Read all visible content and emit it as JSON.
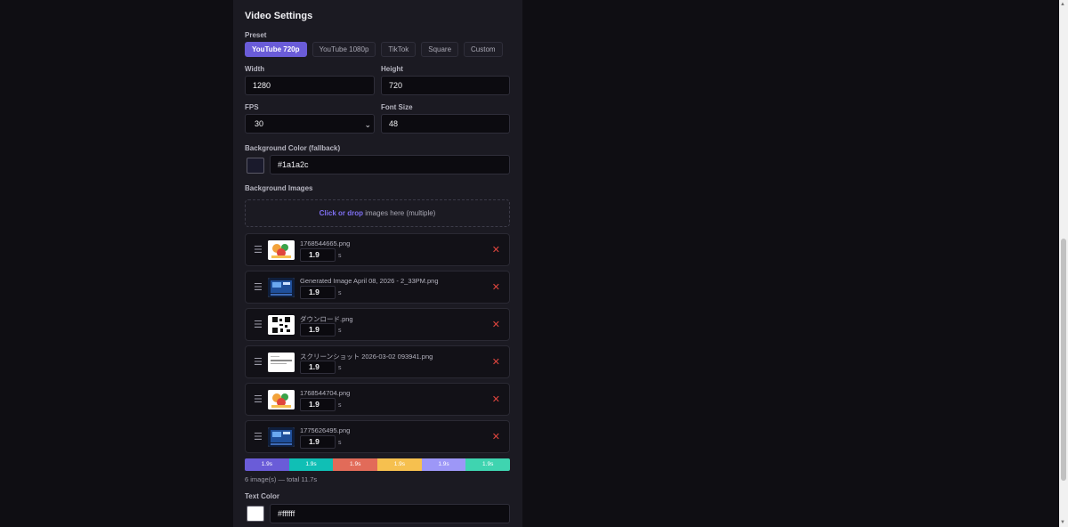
{
  "section_title": "Video Settings",
  "preset": {
    "label": "Preset",
    "options": [
      "YouTube 720p",
      "YouTube 1080p",
      "TikTok",
      "Square",
      "Custom"
    ],
    "active": "YouTube 720p"
  },
  "width": {
    "label": "Width",
    "value": "1280"
  },
  "height": {
    "label": "Height",
    "value": "720"
  },
  "fps": {
    "label": "FPS",
    "value": "30"
  },
  "font_size": {
    "label": "Font Size",
    "value": "48"
  },
  "bg_color": {
    "label": "Background Color (fallback)",
    "value": "#1a1a2c",
    "swatch": "#1a1a2c"
  },
  "bg_images": {
    "label": "Background Images",
    "drop_action": "Click or drop",
    "drop_text": " images here (multiple)",
    "unit": "s",
    "items": [
      {
        "name": "1768544665.png",
        "duration": "1.9",
        "thumb": "food"
      },
      {
        "name": "Generated Image April 08, 2026 - 2_33PM.png",
        "duration": "1.9",
        "thumb": "screen"
      },
      {
        "name": "ダウンロード.png",
        "duration": "1.9",
        "thumb": "qr"
      },
      {
        "name": "スクリーンショット 2026-03-02 093941.png",
        "duration": "1.9",
        "thumb": "doc"
      },
      {
        "name": "1768544704.png",
        "duration": "1.9",
        "thumb": "food"
      },
      {
        "name": "1775626495.png",
        "duration": "1.9",
        "thumb": "screen"
      }
    ]
  },
  "timeline": {
    "segments": [
      {
        "label": "1.9s",
        "color": "#6a5cd8"
      },
      {
        "label": "1.9s",
        "color": "#10bfb5"
      },
      {
        "label": "1.9s",
        "color": "#e26b59"
      },
      {
        "label": "1.9s",
        "color": "#f6c04f"
      },
      {
        "label": "1.9s",
        "color": "#9d97f7"
      },
      {
        "label": "1.9s",
        "color": "#3fd4b0"
      }
    ],
    "summary": "6 image(s) — total 11.7s"
  },
  "text_color": {
    "label": "Text Color",
    "value": "#ffffff",
    "swatch": "#ffffff"
  }
}
